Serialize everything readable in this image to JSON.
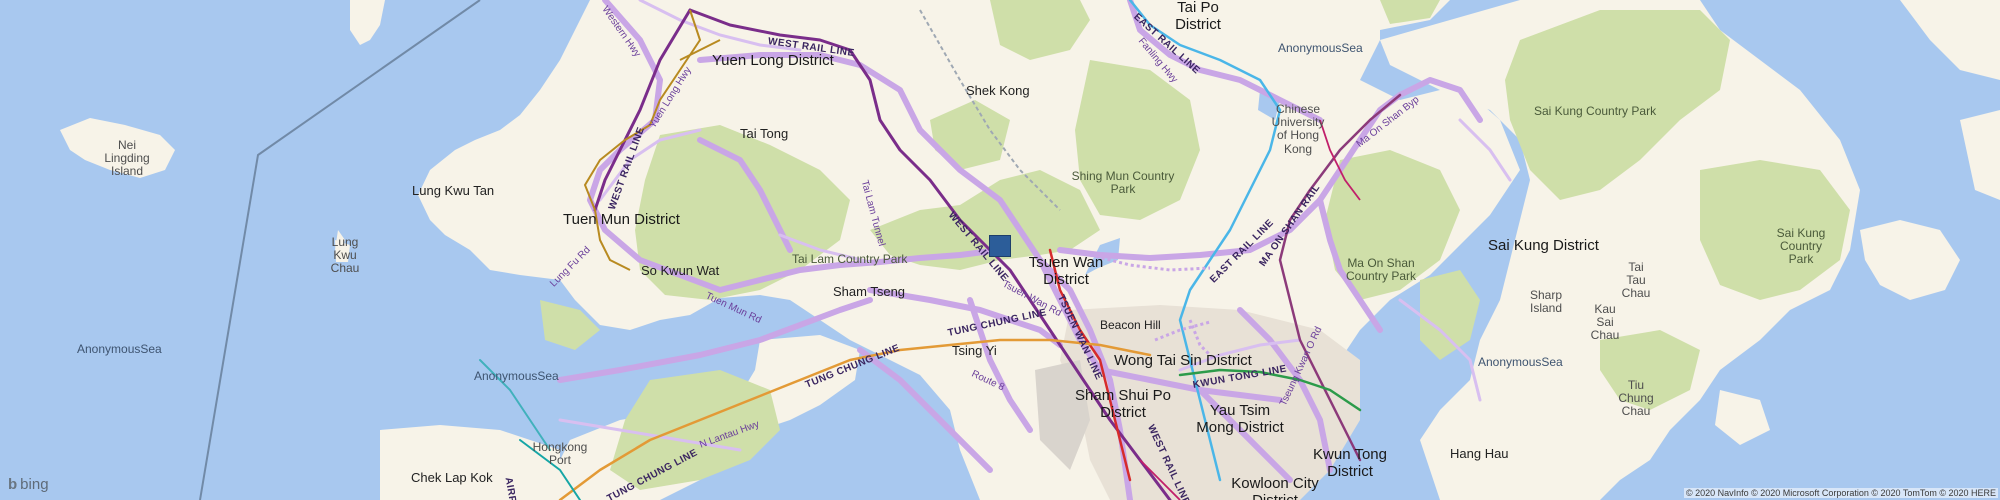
{
  "map": {
    "places": [
      {
        "id": "tai-po",
        "text": "Tai Po\nDistrict",
        "style": "big"
      },
      {
        "id": "yuen-long",
        "text": "Yuen Long District",
        "style": "big"
      },
      {
        "id": "anon-sea-ne",
        "text": "AnonymousSea",
        "style": "sea"
      },
      {
        "id": "shek-kong",
        "text": "Shek Kong",
        "style": "normal"
      },
      {
        "id": "tai-tong",
        "text": "Tai Tong",
        "style": "normal"
      },
      {
        "id": "nei-lingding",
        "text": "Nei\nLingding\nIsland",
        "style": "island"
      },
      {
        "id": "sai-kung-park",
        "text": "Sai Kung Country Park",
        "style": "park"
      },
      {
        "id": "cuhk",
        "text": "Chinese\nUniversity\nof Hong\nKong",
        "style": "island"
      },
      {
        "id": "lung-kwu-tan",
        "text": "Lung Kwu Tan",
        "style": "normal"
      },
      {
        "id": "shing-mun",
        "text": "Shing Mun Country\nPark",
        "style": "park"
      },
      {
        "id": "tuen-mun",
        "text": "Tuen Mun District",
        "style": "big"
      },
      {
        "id": "lung-kwu-chau",
        "text": "Lung\nKwu\nChau",
        "style": "island"
      },
      {
        "id": "sai-kung-district",
        "text": "Sai Kung District",
        "style": "big"
      },
      {
        "id": "sai-kung-country-park-2",
        "text": "Sai Kung\nCountry\nPark",
        "style": "park"
      },
      {
        "id": "tsuen-wan",
        "text": "Tsuen Wan\nDistrict",
        "style": "big"
      },
      {
        "id": "tai-lam",
        "text": "Tai Lam Country Park",
        "style": "park"
      },
      {
        "id": "ma-on-shan",
        "text": "Ma On Shan\nCountry Park",
        "style": "park"
      },
      {
        "id": "so-kwun-wat",
        "text": "So Kwun Wat",
        "style": "normal"
      },
      {
        "id": "tai-tau-chau",
        "text": "Tai\nTau\nChau",
        "style": "island"
      },
      {
        "id": "sham-tseng",
        "text": "Sham Tseng",
        "style": "normal"
      },
      {
        "id": "sharp-island",
        "text": "Sharp\nIsland",
        "style": "island"
      },
      {
        "id": "kau-sai-chau",
        "text": "Kau\nSai\nChau",
        "style": "island"
      },
      {
        "id": "beacon-hill",
        "text": "Beacon Hill",
        "style": "normal"
      },
      {
        "id": "tsing-yi",
        "text": "Tsing Yi",
        "style": "normal"
      },
      {
        "id": "anon-sea-w",
        "text": "AnonymousSea",
        "style": "sea"
      },
      {
        "id": "wong-tai-sin",
        "text": "Wong Tai Sin District",
        "style": "big"
      },
      {
        "id": "anon-sea-e",
        "text": "AnonymousSea",
        "style": "sea"
      },
      {
        "id": "anon-sea-sw",
        "text": "AnonymousSea",
        "style": "sea"
      },
      {
        "id": "sham-shui-po",
        "text": "Sham Shui Po\nDistrict",
        "style": "big"
      },
      {
        "id": "yau-tsim-mong",
        "text": "Yau Tsim\nMong District",
        "style": "big"
      },
      {
        "id": "tiu-chung-chau",
        "text": "Tiu\nChung\nChau",
        "style": "island"
      },
      {
        "id": "hongkong-port",
        "text": "Hongkong\nPort",
        "style": "island"
      },
      {
        "id": "kwun-tong",
        "text": "Kwun Tong\nDistrict",
        "style": "big"
      },
      {
        "id": "hang-hau",
        "text": "Hang Hau",
        "style": "normal"
      },
      {
        "id": "chek-lap-kok",
        "text": "Chek Lap Kok",
        "style": "normal"
      },
      {
        "id": "kowloon-city",
        "text": "Kowloon City\nDistrict",
        "style": "big"
      }
    ],
    "rail_labels": [
      {
        "id": "west-rail-yl",
        "text": "WEST RAIL LINE"
      },
      {
        "id": "west-rail-tm",
        "text": "WEST RAIL LINE"
      },
      {
        "id": "west-rail-tw",
        "text": "WEST RAIL LINE"
      },
      {
        "id": "east-rail-n",
        "text": "EAST RAIL LINE"
      },
      {
        "id": "east-rail-s",
        "text": "EAST RAIL LINE"
      },
      {
        "id": "ma-on-shan-rail",
        "text": "MA ON SHAN RAIL"
      },
      {
        "id": "tsuen-wan-line",
        "text": "TSUEN WAN LINE"
      },
      {
        "id": "tung-chung-1",
        "text": "TUNG CHUNG LINE"
      },
      {
        "id": "tung-chung-2",
        "text": "TUNG CHUNG LINE"
      },
      {
        "id": "tung-chung-3",
        "text": "TUNG CHUNG LINE"
      },
      {
        "id": "kwun-tong-line",
        "text": "KWUN TONG LINE"
      },
      {
        "id": "west-rail-k",
        "text": "WEST RAIL LINE"
      },
      {
        "id": "airport",
        "text": "AIRPO"
      }
    ],
    "road_labels": [
      {
        "id": "western-hwy",
        "text": "Western Hwy"
      },
      {
        "id": "yuen-long-hwy",
        "text": "Yuen Long Hwy"
      },
      {
        "id": "fanling-hwy",
        "text": "Fanling Hwy"
      },
      {
        "id": "ma-on-shan-byp",
        "text": "Ma On Shan Byp"
      },
      {
        "id": "tai-lam-tunnel",
        "text": "Tai Lam Tunnel"
      },
      {
        "id": "lung-fu-rd",
        "text": "Lung Fu Rd"
      },
      {
        "id": "tuen-mun-rd",
        "text": "Tuen Mun Rd"
      },
      {
        "id": "tsuen-wan-rd",
        "text": "Tsuen Wan Rd"
      },
      {
        "id": "route-8",
        "text": "Route 8"
      },
      {
        "id": "n-lantau-hwy",
        "text": "N Lantau Hwy"
      },
      {
        "id": "tseung-kwan-o",
        "text": "Tseung Kwan O Rd"
      }
    ],
    "marker_label": "location marker",
    "branding": {
      "logo_glyph": "b",
      "logo_text": "bing"
    },
    "copyright": "© 2020 NavInfo © 2020 Microsoft Corporation © 2020 TomTom © 2020 HERE"
  },
  "colors": {
    "sea": "#a8c8ef",
    "land": "#f7f3e8",
    "park": "#cfdfa9",
    "urban": "#e8e1d6",
    "highway": "#c9a6e6",
    "rail": "#7a2d8a",
    "marker": "#2c5d99"
  }
}
